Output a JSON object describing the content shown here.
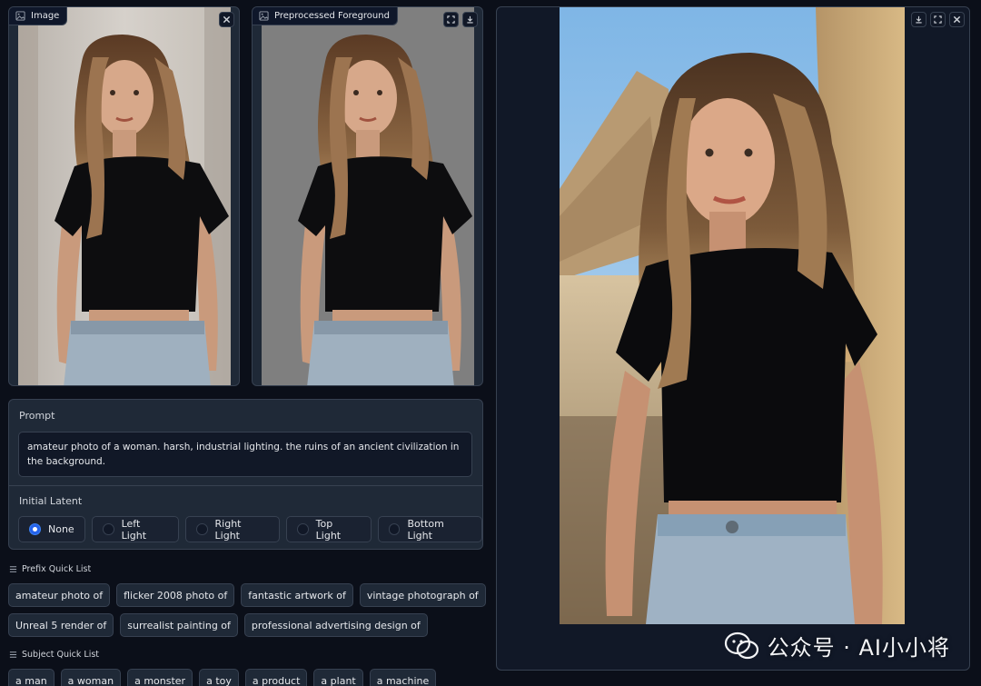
{
  "image_panel": {
    "label": "Image"
  },
  "preprocessed_panel": {
    "label": "Preprocessed Foreground"
  },
  "prompt": {
    "title": "Prompt",
    "value": "amateur photo of a woman. harsh, industrial lighting. the ruins of an ancient civilization in the background."
  },
  "initial_latent": {
    "title": "Initial Latent",
    "options": [
      "None",
      "Left Light",
      "Right Light",
      "Top Light",
      "Bottom Light"
    ],
    "selected": "None"
  },
  "prefix_quick_list": {
    "title": "Prefix Quick List",
    "row1": [
      "amateur photo of",
      "flicker 2008 photo of",
      "fantastic artwork of",
      "vintage photograph of"
    ],
    "row2": [
      "Unreal 5 render of",
      "surrealist painting of",
      "professional advertising design of"
    ]
  },
  "subject_quick_list": {
    "title": "Subject Quick List",
    "items": [
      "a man",
      "a woman",
      "a monster",
      "a toy",
      "a product",
      "a plant",
      "a machine"
    ]
  },
  "watermark": {
    "text": "公众号 · AI小小将"
  },
  "colors": {
    "background": "#0b0f19",
    "panel": "#1f2937",
    "border": "#374151",
    "accent": "#2563eb"
  },
  "icons": [
    "image-icon",
    "close-icon",
    "download-icon",
    "fullscreen-icon",
    "list-icon"
  ]
}
